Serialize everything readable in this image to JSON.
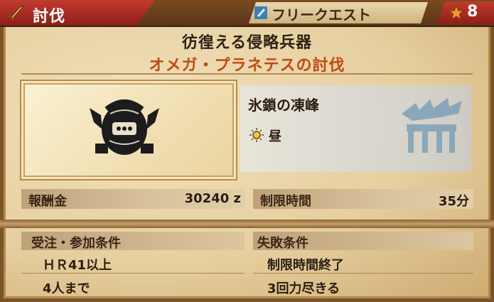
{
  "header": {
    "quest_type": "討伐",
    "quest_type_icon": "sword-icon",
    "category": "フリークエスト",
    "category_icon": "free-quest-book-icon",
    "star_icon": "star-icon",
    "star_rank": "8"
  },
  "quest": {
    "title": "彷徨える侵略兵器",
    "subtitle": "オメガ・プラネテスの討伐"
  },
  "target": {
    "monster_icon": "omega-planetes-icon"
  },
  "locale": {
    "name": "氷鎖の凍峰",
    "time_icon": "sun-icon",
    "time": "昼",
    "map_icon": "locale-emblem-icon"
  },
  "reward": {
    "label": "報酬金",
    "value": "30240 z"
  },
  "time_limit": {
    "label": "制限時間",
    "value": "35分"
  },
  "requirements": {
    "label": "受注・参加条件",
    "items": [
      "ＨＲ41以上",
      "4人まで"
    ]
  },
  "fail_conditions": {
    "label": "失敗条件",
    "items": [
      "制限時間終了",
      "3回力尽きる"
    ]
  },
  "colors": {
    "accent_red": "#b3261e",
    "subtitle_orange": "#c04a14",
    "parchment": "#e6cf9f"
  }
}
